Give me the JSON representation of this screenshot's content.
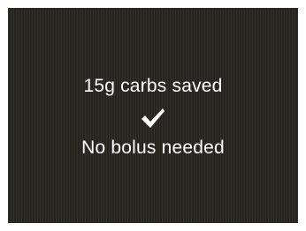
{
  "screen": {
    "message_line1": "15g carbs saved",
    "message_line2": "No bolus needed",
    "status_icon": "checkmark-icon"
  },
  "colors": {
    "background": "#2e2a25",
    "text": "#ffffff"
  }
}
